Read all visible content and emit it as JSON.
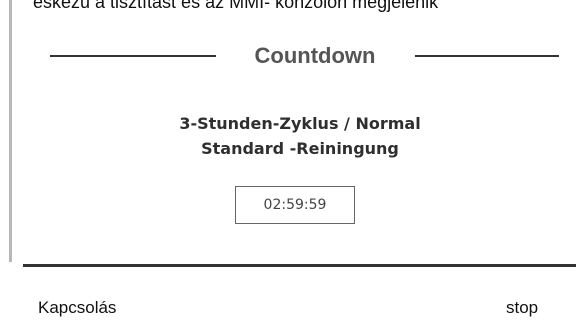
{
  "caption": "eskezu a tisztítást és az MMI- konzolon megjelenik",
  "panel": {
    "title": "Countdown",
    "mode_line1": "3-Stunden-Zyklus / Normal",
    "mode_line2": "Standard -Reiningung",
    "timer": "02:59:59"
  },
  "footer": {
    "left_label": "Kapcsolás",
    "right_label": "stop"
  }
}
